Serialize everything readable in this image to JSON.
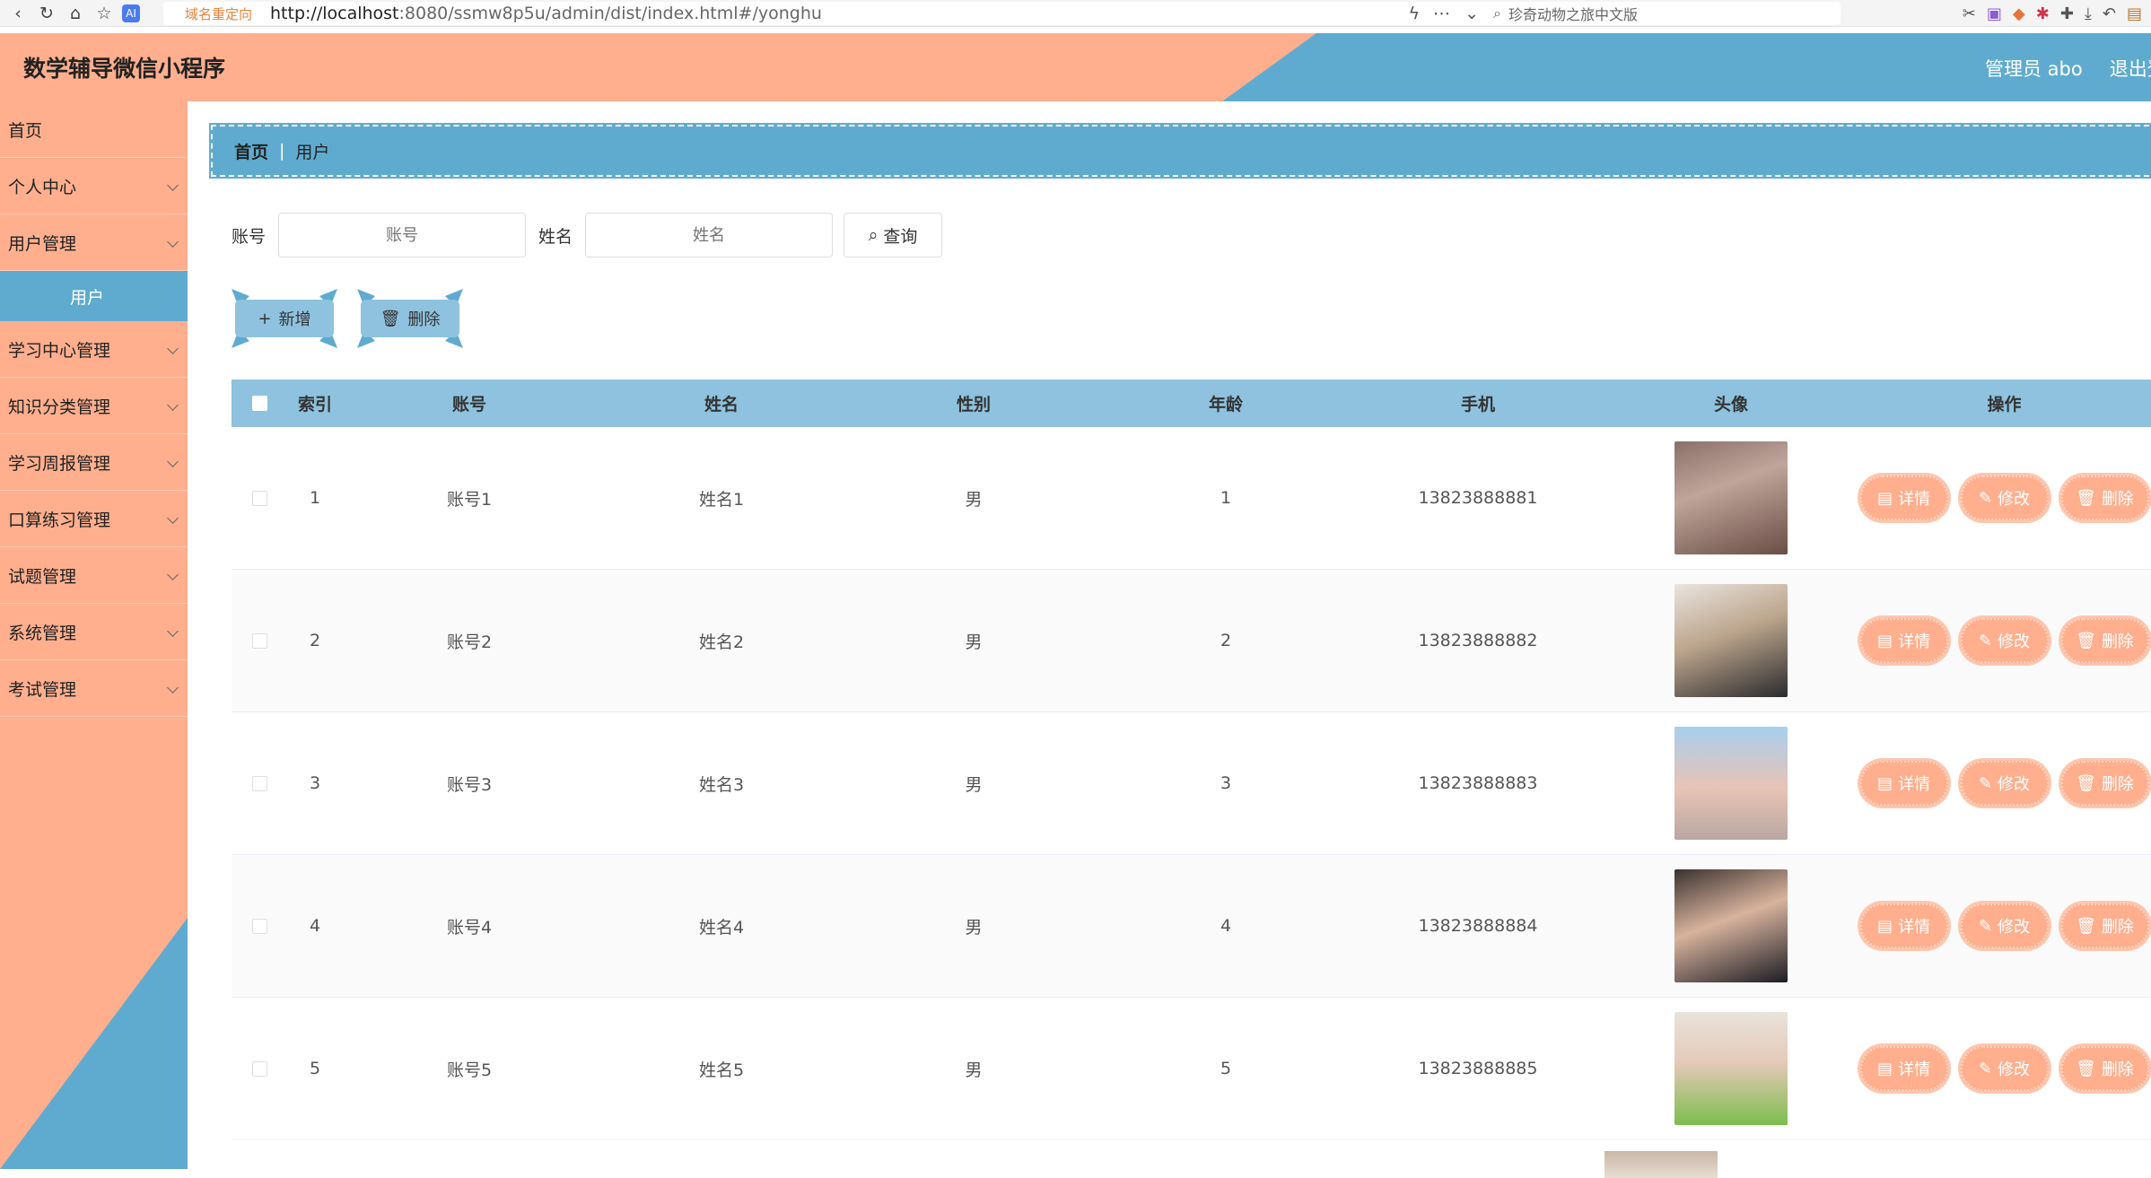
{
  "browser": {
    "redirect_label": "域名重定向",
    "url_host": "http://localhost",
    "url_rest": ":8080/ssmw8p5u/admin/dist/index.html#/yonghu",
    "search_text": "珍奇动物之旅中文版"
  },
  "header": {
    "title": "数学辅导微信小程序",
    "user": "管理员 abo",
    "logout": "退出登录"
  },
  "sidebar": {
    "items": [
      {
        "label": "首页",
        "has_arrow": false
      },
      {
        "label": "个人中心",
        "has_arrow": true
      },
      {
        "label": "用户管理",
        "has_arrow": true
      },
      {
        "label": "学习中心管理",
        "has_arrow": true
      },
      {
        "label": "知识分类管理",
        "has_arrow": true
      },
      {
        "label": "学习周报管理",
        "has_arrow": true
      },
      {
        "label": "口算练习管理",
        "has_arrow": true
      },
      {
        "label": "试题管理",
        "has_arrow": true
      },
      {
        "label": "系统管理",
        "has_arrow": true
      },
      {
        "label": "考试管理",
        "has_arrow": true
      }
    ],
    "active_sub": "用户"
  },
  "breadcrumb": {
    "home": "首页",
    "current": "用户"
  },
  "search": {
    "account_label": "账号",
    "account_placeholder": "账号",
    "name_label": "姓名",
    "name_placeholder": "姓名",
    "query_button": "查询"
  },
  "actions": {
    "add": "新增",
    "delete": "删除"
  },
  "table": {
    "columns": [
      "索引",
      "账号",
      "姓名",
      "性别",
      "年龄",
      "手机",
      "头像",
      "操作"
    ],
    "rows": [
      {
        "index": "1",
        "account": "账号1",
        "name": "姓名1",
        "sex": "男",
        "age": "1",
        "phone": "13823888881"
      },
      {
        "index": "2",
        "account": "账号2",
        "name": "姓名2",
        "sex": "男",
        "age": "2",
        "phone": "13823888882"
      },
      {
        "index": "3",
        "account": "账号3",
        "name": "姓名3",
        "sex": "男",
        "age": "3",
        "phone": "13823888883"
      },
      {
        "index": "4",
        "account": "账号4",
        "name": "姓名4",
        "sex": "男",
        "age": "4",
        "phone": "13823888884"
      },
      {
        "index": "5",
        "account": "账号5",
        "name": "姓名5",
        "sex": "男",
        "age": "5",
        "phone": "13823888885"
      }
    ],
    "row_actions": {
      "detail": "详情",
      "edit": "修改",
      "delete": "删除"
    }
  },
  "colors": {
    "peach": "#ffaf8e",
    "blue": "#5fabd0",
    "light_blue": "#8ec2de"
  }
}
